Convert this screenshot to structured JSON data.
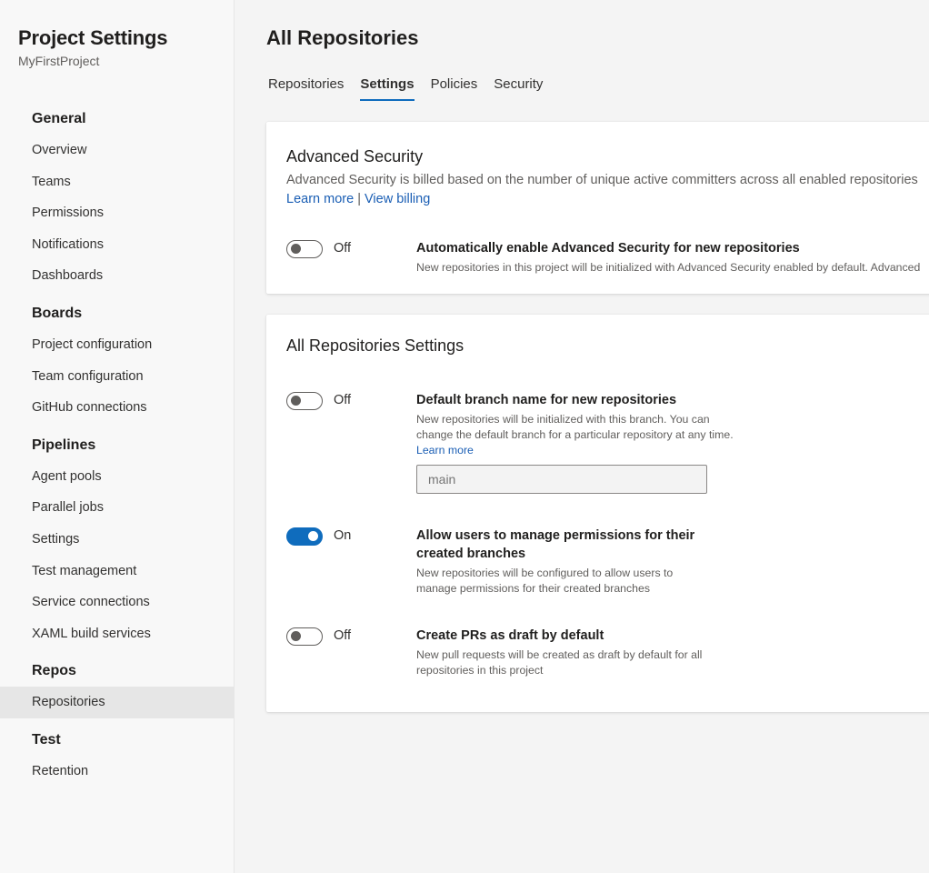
{
  "sidebar": {
    "title": "Project Settings",
    "project": "MyFirstProject",
    "groups": [
      {
        "title": "General",
        "items": [
          "Overview",
          "Teams",
          "Permissions",
          "Notifications",
          "Dashboards"
        ]
      },
      {
        "title": "Boards",
        "items": [
          "Project configuration",
          "Team configuration",
          "GitHub connections"
        ]
      },
      {
        "title": "Pipelines",
        "items": [
          "Agent pools",
          "Parallel jobs",
          "Settings",
          "Test management",
          "Service connections",
          "XAML build services"
        ]
      },
      {
        "title": "Repos",
        "items": [
          "Repositories"
        ]
      },
      {
        "title": "Test",
        "items": [
          "Retention"
        ]
      }
    ]
  },
  "main": {
    "title": "All Repositories",
    "tabs": [
      "Repositories",
      "Settings",
      "Policies",
      "Security"
    ],
    "active_tab": "Settings",
    "advanced_security": {
      "title": "Advanced Security",
      "description": "Advanced Security is billed based on the number of unique active committers across all enabled repositories",
      "learn_more": "Learn more",
      "separator": "|",
      "view_billing": "View billing",
      "toggle_state": "Off",
      "setting_title": "Automatically enable Advanced Security for new repositories",
      "setting_desc": "New repositories in this project will be initialized with Advanced Security enabled by default. Advanced"
    },
    "repo_settings": {
      "title": "All Repositories Settings",
      "default_branch": {
        "toggle_state": "Off",
        "title": "Default branch name for new repositories",
        "desc": "New repositories will be initialized with this branch. You can change the default branch for a particular repository at any time.",
        "learn_more": "Learn more",
        "placeholder": "main"
      },
      "manage_permissions": {
        "toggle_state": "On",
        "title": "Allow users to manage permissions for their created branches",
        "desc": "New repositories will be configured to allow users to manage permissions for their created branches"
      },
      "draft_prs": {
        "toggle_state": "Off",
        "title": "Create PRs as draft by default",
        "desc": "New pull requests will be created as draft by default for all repositories in this project"
      }
    }
  },
  "colors": {
    "accent": "#0f6cbd",
    "link": "#1a5eb4",
    "selected_nav": "#e6e6e6"
  }
}
